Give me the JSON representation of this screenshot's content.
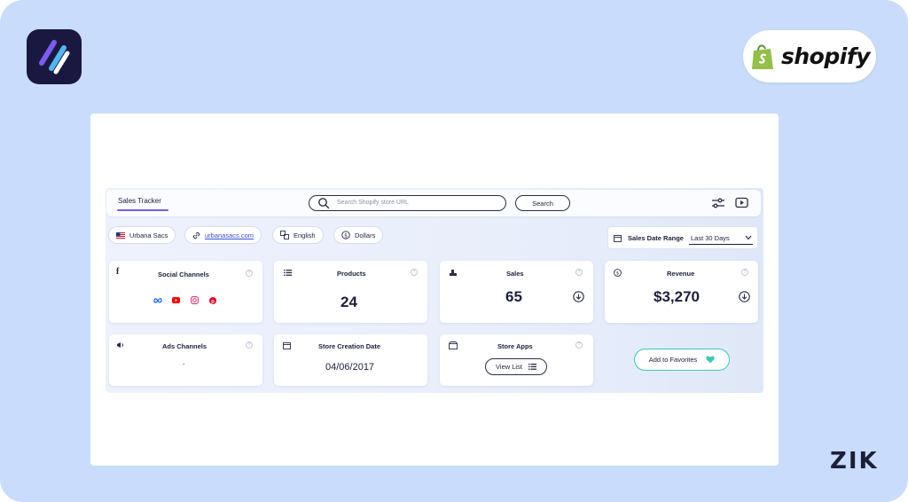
{
  "brand": {
    "shopify_wordmark": "shopify",
    "zik_logo": "ZIK"
  },
  "toolbar": {
    "tab_label": "Sales Tracker",
    "search_placeholder": "Search Shopify store URL",
    "search_button": "Search"
  },
  "store_info": {
    "name": "Urbana Sacs",
    "url": "urbanasacs.com",
    "language": "English",
    "currency": "Dollars"
  },
  "date_range": {
    "label": "Sales Date Range",
    "value": "Last 30 Days"
  },
  "stats": {
    "social_channels": {
      "title": "Social Channels"
    },
    "products": {
      "title": "Products",
      "value": "24"
    },
    "sales": {
      "title": "Sales",
      "value": "65"
    },
    "revenue": {
      "title": "Revenue",
      "value": "$3,270"
    },
    "ads_channels": {
      "title": "Ads Channels",
      "value": "-"
    },
    "store_creation": {
      "title": "Store Creation Date",
      "value": "04/06/2017"
    },
    "store_apps": {
      "title": "Store Apps",
      "button": "View List"
    }
  },
  "favorites_button": "Add to Favorites",
  "help_glyph": "?",
  "colors": {
    "background": "#c9dcfb",
    "accent_purple": "#7b5cf0",
    "accent_teal": "#3cc9b4",
    "text_dark": "#1c1f3a",
    "meta_blue": "#0866ff",
    "youtube_red": "#ff0000",
    "instagram_pink": "#e1306c",
    "pinterest_red": "#e60023",
    "shopify_green": "#95bf47"
  }
}
